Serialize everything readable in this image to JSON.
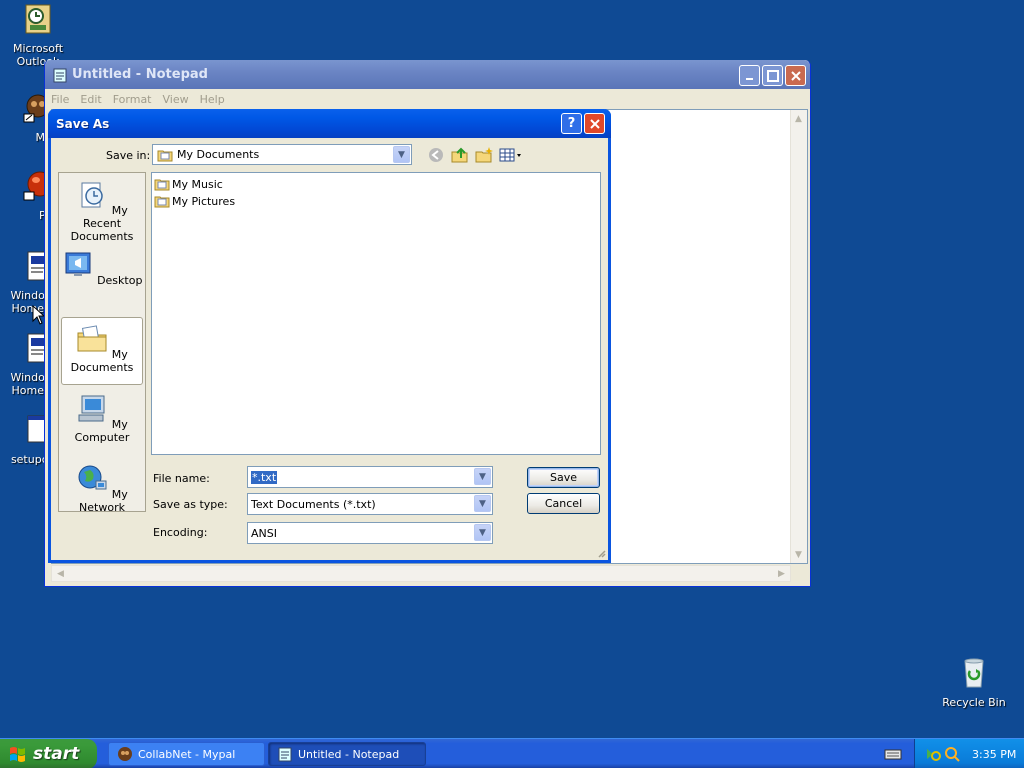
{
  "desktop": {
    "icons": [
      {
        "label": "Microsoft Outlook"
      },
      {
        "label": "MyPa"
      },
      {
        "label": "Peg"
      },
      {
        "label": "Windows Home Pr"
      },
      {
        "label": "Windows Home Pr"
      },
      {
        "label": "setupcer"
      },
      {
        "label": "Recycle Bin"
      }
    ]
  },
  "notepad": {
    "title": "Untitled - Notepad",
    "menu": [
      "File",
      "Edit",
      "Format",
      "View",
      "Help"
    ]
  },
  "dialog": {
    "title": "Save As",
    "save_in_label": "Save in:",
    "save_in_value": "My Documents",
    "places": [
      {
        "label": "My Recent Documents"
      },
      {
        "label": "Desktop"
      },
      {
        "label": "My Documents"
      },
      {
        "label": "My Computer"
      },
      {
        "label": "My Network"
      }
    ],
    "files": [
      "My Music",
      "My Pictures"
    ],
    "file_name_label": "File name:",
    "file_name_value": "*.txt",
    "save_as_type_label": "Save as type:",
    "save_as_type_value": "Text Documents (*.txt)",
    "encoding_label": "Encoding:",
    "encoding_value": "ANSI",
    "save_button": "Save",
    "cancel_button": "Cancel"
  },
  "taskbar": {
    "start_label": "start",
    "tasks": [
      {
        "label": "CollabNet - Mypal"
      },
      {
        "label": "Untitled - Notepad"
      }
    ],
    "clock": "3:35 PM"
  }
}
